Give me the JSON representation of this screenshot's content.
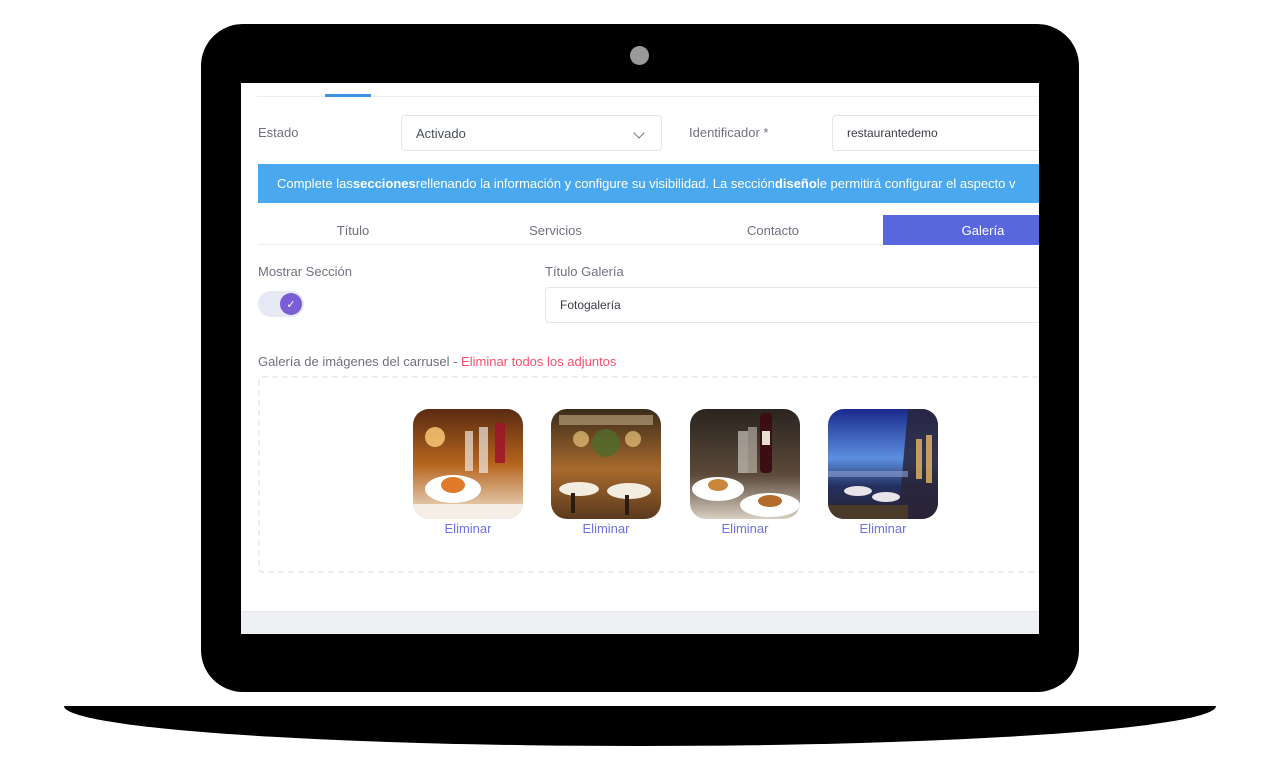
{
  "form": {
    "estado_label": "Estado",
    "estado_value": "Activado",
    "identificador_label": "Identificador *",
    "identificador_value": "restaurantedemo"
  },
  "banner": {
    "text_1": "Complete las ",
    "bold_1": "secciones",
    "text_2": " rellenando la información y configure su visibilidad. La sección ",
    "bold_2": "diseño",
    "text_3": " le permitirá configurar el aspecto v"
  },
  "tabs": [
    {
      "label": "Título",
      "active": false
    },
    {
      "label": "Servicios",
      "active": false
    },
    {
      "label": "Contacto",
      "active": false
    },
    {
      "label": "Galería",
      "active": true
    }
  ],
  "section": {
    "show_label": "Mostrar Sección",
    "show_enabled": true,
    "title_label": "Título Galería",
    "title_value": "Fotogalería"
  },
  "gallery": {
    "label": "Galería de imágenes del carrusel - ",
    "delete_all": "Eliminar todos los adjuntos",
    "images": [
      {
        "alt": "restaurant-table-wine-glasses",
        "remove_label": "Eliminar"
      },
      {
        "alt": "restaurant-dining-room",
        "remove_label": "Eliminar"
      },
      {
        "alt": "wine-and-tapas",
        "remove_label": "Eliminar"
      },
      {
        "alt": "terrace-at-dusk",
        "remove_label": "Eliminar"
      }
    ]
  },
  "colors": {
    "accent": "#5867dd",
    "banner": "#4aa8ef",
    "danger": "#f4516c",
    "link": "#6c72e6",
    "toggle": "#7b5ed6"
  }
}
